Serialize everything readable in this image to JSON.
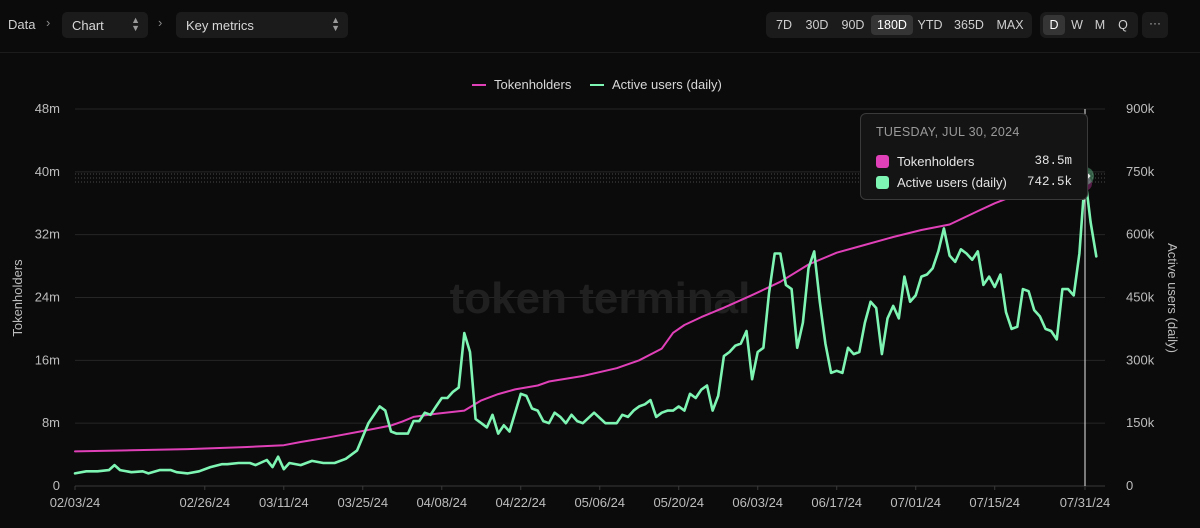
{
  "breadcrumb": {
    "root": "Data",
    "chart_select": "Chart",
    "metric_select": "Key metrics"
  },
  "timeframes": [
    "7D",
    "30D",
    "90D",
    "180D",
    "YTD",
    "365D",
    "MAX"
  ],
  "active_timeframe": "180D",
  "granularity": [
    "D",
    "W",
    "M",
    "Q"
  ],
  "active_granularity": "D",
  "more_label": "···",
  "colors": {
    "tokenholders": "#e040b8",
    "active_users": "#7ff5b3",
    "background": "#0b0b0b"
  },
  "watermark": "token terminal",
  "tooltip": {
    "date": "TUESDAY, JUL 30, 2024",
    "rows": [
      {
        "name": "Tokenholders",
        "value": "38.5m"
      },
      {
        "name": "Active users (daily)",
        "value": "742.5k"
      }
    ]
  },
  "chart_data": {
    "type": "line",
    "legend_position": "top-center",
    "grid": true,
    "x_tick_labels": [
      "02/03/24",
      "02/26/24",
      "03/11/24",
      "03/25/24",
      "04/08/24",
      "04/22/24",
      "05/06/24",
      "05/20/24",
      "06/03/24",
      "06/17/24",
      "07/01/24",
      "07/15/24",
      "07/31/24"
    ],
    "x_tick_days": [
      0,
      23,
      37,
      51,
      65,
      79,
      93,
      107,
      121,
      135,
      149,
      163,
      179
    ],
    "x_start_date": "2024-02-03",
    "ylabel_left": "Tokenholders",
    "ylabel_right": "Active users (daily)",
    "y_left_ticks": [
      "0",
      "8m",
      "16m",
      "24m",
      "32m",
      "40m",
      "48m"
    ],
    "y_left_lim": [
      0,
      48000000
    ],
    "y_right_ticks": [
      "0",
      "150k",
      "300k",
      "450k",
      "600k",
      "750k",
      "900k"
    ],
    "y_right_lim": [
      0,
      900000
    ],
    "highlight_day": 178,
    "series": [
      {
        "name": "Tokenholders",
        "axis": "left",
        "points": [
          [
            0,
            4400000
          ],
          [
            10,
            4550000
          ],
          [
            20,
            4700000
          ],
          [
            30,
            4950000
          ],
          [
            37,
            5200000
          ],
          [
            40,
            5600000
          ],
          [
            45,
            6200000
          ],
          [
            51,
            7000000
          ],
          [
            56,
            7700000
          ],
          [
            58,
            8200000
          ],
          [
            60,
            8800000
          ],
          [
            64,
            9200000
          ],
          [
            69,
            9600000
          ],
          [
            72,
            10900000
          ],
          [
            75,
            11700000
          ],
          [
            78,
            12300000
          ],
          [
            82,
            12800000
          ],
          [
            84,
            13300000
          ],
          [
            90,
            14000000
          ],
          [
            96,
            15000000
          ],
          [
            100,
            16000000
          ],
          [
            104,
            17500000
          ],
          [
            106,
            19500000
          ],
          [
            108,
            20500000
          ],
          [
            111,
            21500000
          ],
          [
            115,
            22700000
          ],
          [
            120,
            24300000
          ],
          [
            125,
            26000000
          ],
          [
            130,
            28200000
          ],
          [
            135,
            29700000
          ],
          [
            140,
            30700000
          ],
          [
            145,
            31700000
          ],
          [
            150,
            32600000
          ],
          [
            155,
            33300000
          ],
          [
            160,
            35000000
          ],
          [
            163,
            36000000
          ],
          [
            168,
            37400000
          ],
          [
            175,
            38400000
          ],
          [
            178,
            38500000
          ]
        ]
      },
      {
        "name": "Active users (daily)",
        "axis": "right",
        "points": [
          [
            0,
            30000
          ],
          [
            2,
            35000
          ],
          [
            4,
            35000
          ],
          [
            6,
            38000
          ],
          [
            7,
            50000
          ],
          [
            8,
            38000
          ],
          [
            10,
            33000
          ],
          [
            12,
            35000
          ],
          [
            13,
            30000
          ],
          [
            15,
            38000
          ],
          [
            17,
            38000
          ],
          [
            18,
            33000
          ],
          [
            20,
            30000
          ],
          [
            22,
            35000
          ],
          [
            24,
            45000
          ],
          [
            26,
            52000
          ],
          [
            27,
            52000
          ],
          [
            29,
            55000
          ],
          [
            31,
            55000
          ],
          [
            32,
            50000
          ],
          [
            34,
            62000
          ],
          [
            35,
            45000
          ],
          [
            36,
            70000
          ],
          [
            37,
            40000
          ],
          [
            38,
            55000
          ],
          [
            40,
            50000
          ],
          [
            42,
            60000
          ],
          [
            44,
            55000
          ],
          [
            46,
            55000
          ],
          [
            48,
            65000
          ],
          [
            50,
            85000
          ],
          [
            52,
            150000
          ],
          [
            54,
            190000
          ],
          [
            55,
            180000
          ],
          [
            56,
            130000
          ],
          [
            57,
            125000
          ],
          [
            59,
            125000
          ],
          [
            60,
            155000
          ],
          [
            61,
            155000
          ],
          [
            62,
            175000
          ],
          [
            63,
            170000
          ],
          [
            64,
            190000
          ],
          [
            65,
            210000
          ],
          [
            66,
            210000
          ],
          [
            67,
            225000
          ],
          [
            68,
            235000
          ],
          [
            69,
            365000
          ],
          [
            70,
            320000
          ],
          [
            71,
            160000
          ],
          [
            72,
            150000
          ],
          [
            73,
            140000
          ],
          [
            74,
            170000
          ],
          [
            75,
            125000
          ],
          [
            76,
            145000
          ],
          [
            77,
            130000
          ],
          [
            79,
            220000
          ],
          [
            80,
            215000
          ],
          [
            81,
            185000
          ],
          [
            82,
            180000
          ],
          [
            83,
            155000
          ],
          [
            84,
            150000
          ],
          [
            85,
            175000
          ],
          [
            86,
            165000
          ],
          [
            87,
            150000
          ],
          [
            88,
            170000
          ],
          [
            89,
            155000
          ],
          [
            90,
            150000
          ],
          [
            92,
            175000
          ],
          [
            94,
            150000
          ],
          [
            96,
            150000
          ],
          [
            97,
            170000
          ],
          [
            98,
            165000
          ],
          [
            99,
            180000
          ],
          [
            100,
            190000
          ],
          [
            101,
            195000
          ],
          [
            102,
            205000
          ],
          [
            103,
            165000
          ],
          [
            104,
            175000
          ],
          [
            105,
            180000
          ],
          [
            106,
            180000
          ],
          [
            107,
            190000
          ],
          [
            108,
            180000
          ],
          [
            109,
            220000
          ],
          [
            110,
            210000
          ],
          [
            111,
            230000
          ],
          [
            112,
            240000
          ],
          [
            113,
            180000
          ],
          [
            114,
            215000
          ],
          [
            115,
            310000
          ],
          [
            116,
            320000
          ],
          [
            117,
            335000
          ],
          [
            118,
            340000
          ],
          [
            119,
            370000
          ],
          [
            120,
            255000
          ],
          [
            121,
            320000
          ],
          [
            122,
            330000
          ],
          [
            123,
            460000
          ],
          [
            124,
            555000
          ],
          [
            125,
            555000
          ],
          [
            126,
            480000
          ],
          [
            127,
            470000
          ],
          [
            128,
            330000
          ],
          [
            129,
            390000
          ],
          [
            130,
            520000
          ],
          [
            131,
            560000
          ],
          [
            132,
            440000
          ],
          [
            133,
            340000
          ],
          [
            134,
            270000
          ],
          [
            135,
            275000
          ],
          [
            136,
            270000
          ],
          [
            137,
            330000
          ],
          [
            138,
            315000
          ],
          [
            139,
            320000
          ],
          [
            140,
            390000
          ],
          [
            141,
            440000
          ],
          [
            142,
            425000
          ],
          [
            143,
            315000
          ],
          [
            144,
            400000
          ],
          [
            145,
            430000
          ],
          [
            146,
            400000
          ],
          [
            147,
            500000
          ],
          [
            148,
            440000
          ],
          [
            149,
            455000
          ],
          [
            150,
            500000
          ],
          [
            151,
            505000
          ],
          [
            152,
            520000
          ],
          [
            153,
            560000
          ],
          [
            154,
            615000
          ],
          [
            155,
            550000
          ],
          [
            156,
            535000
          ],
          [
            157,
            565000
          ],
          [
            158,
            555000
          ],
          [
            159,
            540000
          ],
          [
            160,
            560000
          ],
          [
            161,
            480000
          ],
          [
            162,
            500000
          ],
          [
            163,
            475000
          ],
          [
            164,
            505000
          ],
          [
            165,
            415000
          ],
          [
            166,
            375000
          ],
          [
            167,
            380000
          ],
          [
            168,
            470000
          ],
          [
            169,
            465000
          ],
          [
            170,
            420000
          ],
          [
            171,
            405000
          ],
          [
            172,
            375000
          ],
          [
            173,
            370000
          ],
          [
            174,
            350000
          ],
          [
            175,
            470000
          ],
          [
            176,
            470000
          ],
          [
            177,
            455000
          ],
          [
            178,
            555000
          ],
          [
            179,
            740000
          ],
          [
            180,
            630000
          ],
          [
            181,
            548000
          ]
        ]
      }
    ]
  }
}
